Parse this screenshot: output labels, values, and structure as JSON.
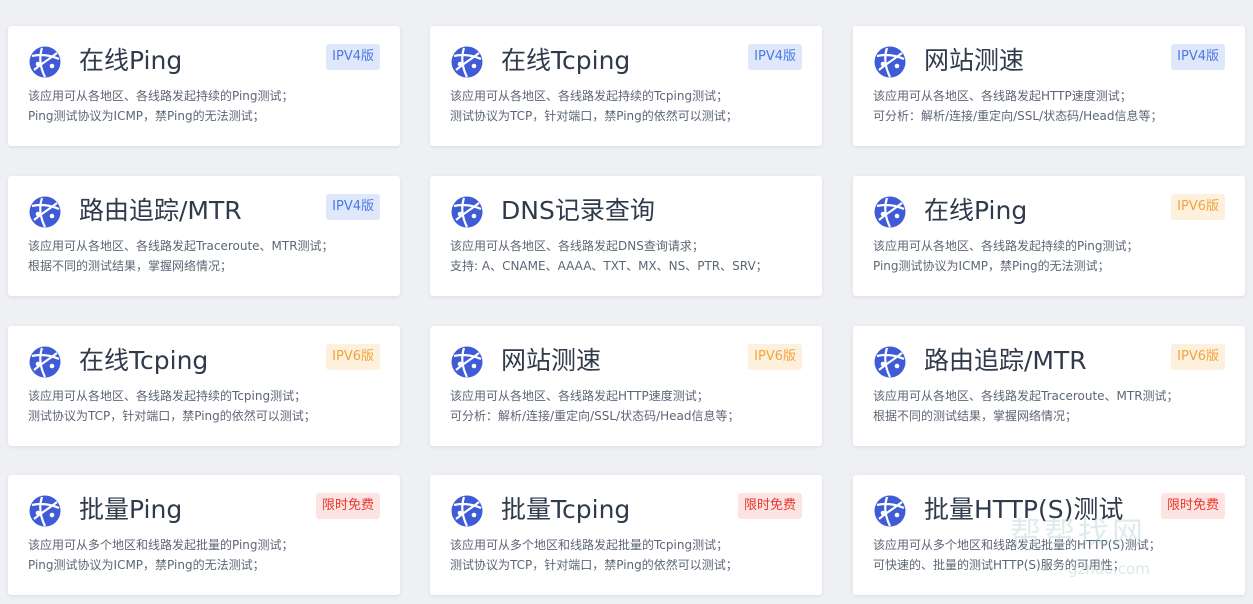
{
  "cards": [
    {
      "title": "在线Ping",
      "badge": "IPV4版",
      "badge_type": "ipv4",
      "desc": [
        "该应用可从各地区、各线路发起持续的Ping测试；",
        "Ping测试协议为ICMP，禁Ping的无法测试；"
      ]
    },
    {
      "title": "在线Tcping",
      "badge": "IPV4版",
      "badge_type": "ipv4",
      "desc": [
        "该应用可从各地区、各线路发起持续的Tcping测试；",
        "测试协议为TCP，针对端口，禁Ping的依然可以测试；"
      ]
    },
    {
      "title": "网站测速",
      "badge": "IPV4版",
      "badge_type": "ipv4",
      "desc": [
        "该应用可从各地区、各线路发起HTTP速度测试；",
        "可分析：解析/连接/重定向/SSL/状态码/Head信息等；"
      ]
    },
    {
      "title": "路由追踪/MTR",
      "badge": "IPV4版",
      "badge_type": "ipv4",
      "desc": [
        "该应用可从各地区、各线路发起Traceroute、MTR测试；",
        "根据不同的测试结果，掌握网络情况；"
      ]
    },
    {
      "title": "DNS记录查询",
      "badge": "",
      "badge_type": "",
      "desc": [
        "该应用可从各地区、各线路发起DNS查询请求；",
        "支持: A、CNAME、AAAA、TXT、MX、NS、PTR、SRV；"
      ]
    },
    {
      "title": "在线Ping",
      "badge": "IPV6版",
      "badge_type": "ipv6",
      "desc": [
        "该应用可从各地区、各线路发起持续的Ping测试；",
        "Ping测试协议为ICMP，禁Ping的无法测试；"
      ]
    },
    {
      "title": "在线Tcping",
      "badge": "IPV6版",
      "badge_type": "ipv6",
      "desc": [
        "该应用可从各地区、各线路发起持续的Tcping测试；",
        "测试协议为TCP，针对端口，禁Ping的依然可以测试；"
      ]
    },
    {
      "title": "网站测速",
      "badge": "IPV6版",
      "badge_type": "ipv6",
      "desc": [
        "该应用可从各地区、各线路发起HTTP速度测试；",
        "可分析：解析/连接/重定向/SSL/状态码/Head信息等；"
      ]
    },
    {
      "title": "路由追踪/MTR",
      "badge": "IPV6版",
      "badge_type": "ipv6",
      "desc": [
        "该应用可从各地区、各线路发起Traceroute、MTR测试；",
        "根据不同的测试结果，掌握网络情况；"
      ]
    },
    {
      "title": "批量Ping",
      "badge": "限时免费",
      "badge_type": "free",
      "desc": [
        "该应用可从多个地区和线路发起批量的Ping测试；",
        "Ping测试协议为ICMP，禁Ping的无法测试；"
      ]
    },
    {
      "title": "批量Tcping",
      "badge": "限时免费",
      "badge_type": "free",
      "desc": [
        "该应用可从多个地区和线路发起批量的Tcping测试；",
        "测试协议为TCP，针对端口，禁Ping的依然可以测试；"
      ]
    },
    {
      "title": "批量HTTP(S)测试",
      "badge": "限时免费",
      "badge_type": "free",
      "desc": [
        "该应用可从多个地区和线路发起批量的HTTP(S)测试；",
        "可快速的、批量的测试HTTP(S)服务的可用性；"
      ]
    }
  ],
  "icon": "globe-logo-icon",
  "colors": {
    "ipv4": "#4b78e6",
    "ipv6": "#f1a43c",
    "free": "#e8372d",
    "logo": "#3f5bd6"
  },
  "watermark": {
    "text": "帮帮找网",
    "sub": "gzhao.com"
  }
}
